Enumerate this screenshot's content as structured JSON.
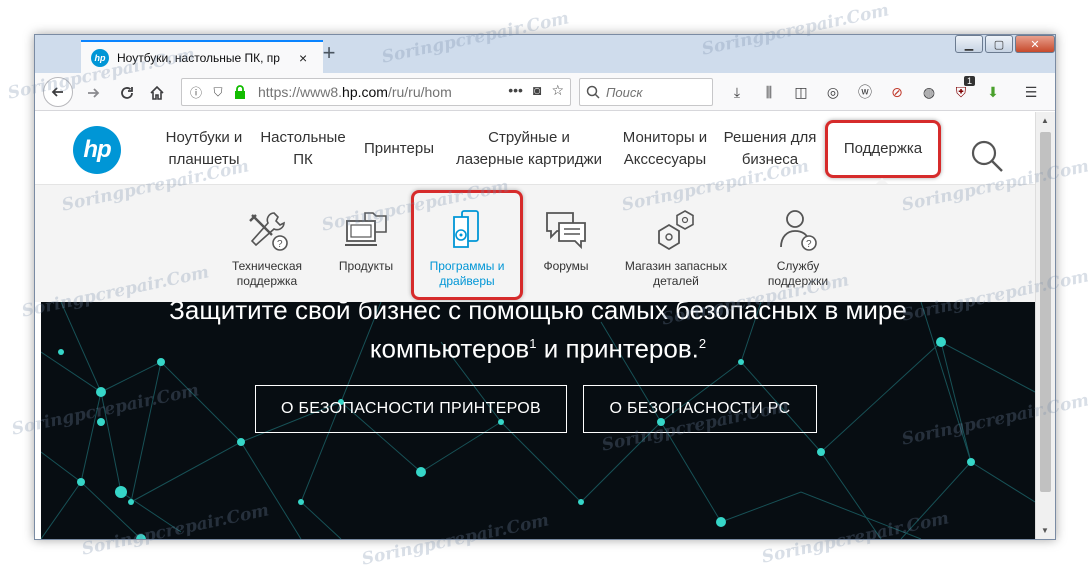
{
  "browser": {
    "tab_title": "Ноутбуки, настольные ПК, пр",
    "tab_close": "×",
    "new_tab": "+",
    "url_main": "https://www8.",
    "url_host": "hp.com",
    "url_tail": "/ru/ru/hom",
    "url_more": "•••",
    "search_placeholder": "Поиск",
    "notification_badge": "1"
  },
  "window_controls": {
    "minimize": "▁",
    "maximize": "▢",
    "close": "✕"
  },
  "site": {
    "logo_text": "hp",
    "menu": [
      {
        "label": "Ноутбуки и\nпланшеты"
      },
      {
        "label": "Настольные\nПК"
      },
      {
        "label": "Принтеры"
      },
      {
        "label": "Струйные и\nлазерные картриджи"
      },
      {
        "label": "Мониторы и\nАкссесуары"
      },
      {
        "label": "Решения для\nбизнеса"
      },
      {
        "label": "Поддержка"
      }
    ],
    "support_menu": [
      {
        "label": "Техническая\nподдержка",
        "icon": "tools-question-icon"
      },
      {
        "label": "Продукты",
        "icon": "computer-folder-icon"
      },
      {
        "label": "Программы и\nдрайверы",
        "icon": "software-disc-icon"
      },
      {
        "label": "Форумы",
        "icon": "chat-bubbles-icon"
      },
      {
        "label": "Магазин запасных\nдеталей",
        "icon": "hexagon-parts-icon"
      },
      {
        "label": "Службу\nподдержки",
        "icon": "person-question-icon"
      }
    ],
    "hero": {
      "line1": "Защитите свой бизнес с помощью самых безопасных в мире",
      "line2_a": "компьютеров",
      "sup1": "1",
      "line2_b": " и принтеров.",
      "sup2": "2",
      "button_printers": "О БЕЗОПАСНОСТИ ПРИНТЕРОВ",
      "button_pc": "О БЕЗОПАСНОСТИ PC"
    }
  },
  "watermark": "Soringpcrepair.Com",
  "colors": {
    "hp_blue": "#0096d6",
    "highlight_red": "#d62b2b",
    "hero_bg": "#070d12",
    "node_teal": "#36d6c8"
  }
}
